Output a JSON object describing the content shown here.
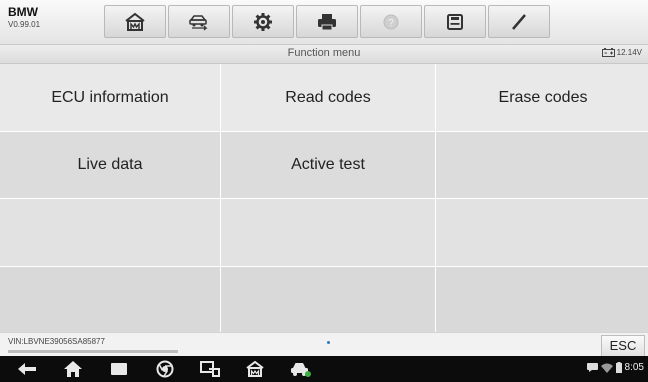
{
  "header": {
    "make": "BMW",
    "version": "V0.99.01",
    "toolbar": [
      {
        "icon": "home-icon"
      },
      {
        "icon": "vehicle-swap-icon"
      },
      {
        "icon": "settings-gear-icon"
      },
      {
        "icon": "printer-icon"
      },
      {
        "icon": "help-icon"
      },
      {
        "icon": "save-icon"
      },
      {
        "icon": "pen-icon"
      }
    ]
  },
  "subheader": {
    "title": "Function menu",
    "voltage": "12.14V"
  },
  "menu": {
    "items": [
      "ECU information",
      "Read codes",
      "Erase codes",
      "Live data",
      "Active test",
      "",
      "",
      "",
      "",
      "",
      "",
      ""
    ]
  },
  "footer": {
    "vin": "VIN:LBVNE39056SA85877",
    "esc_label": "ESC"
  },
  "navbar": {
    "time": "8:05",
    "icons": [
      "back-icon",
      "home-icon",
      "recent-apps-icon",
      "chrome-icon",
      "scan-connect-icon",
      "diagnostics-home-icon",
      "car-icon"
    ]
  },
  "colors": {
    "navbar_bg": "#0c0c0c",
    "accent_dot": "#2b78c5",
    "car_badge": "#3cb043"
  }
}
